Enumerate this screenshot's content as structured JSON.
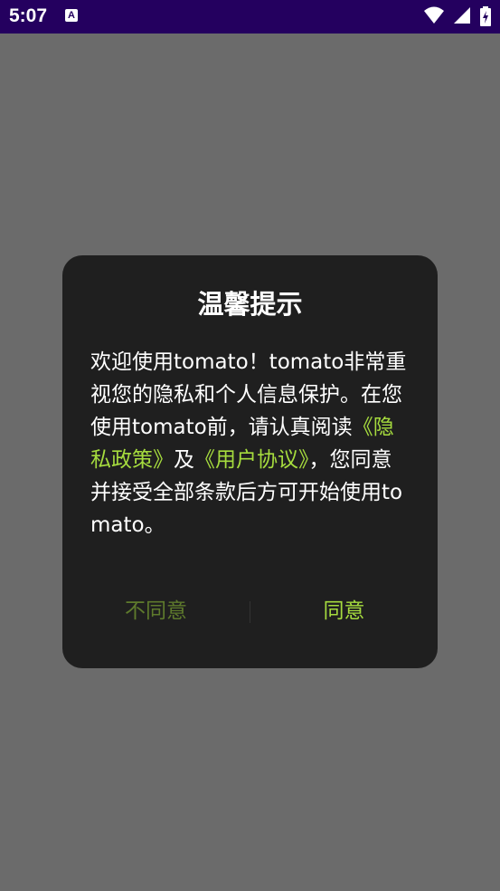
{
  "status_bar": {
    "time": "5:07",
    "app_icon_letter": "A",
    "icons": [
      "wifi-icon",
      "signal-icon",
      "battery-charging-icon"
    ]
  },
  "dialog": {
    "title": "温馨提示",
    "body": {
      "intro": "欢迎使用tomato！tomato非常重视您的隐私和个人信息保护。在您使用tomato前，请认真阅读",
      "privacy_link": "《隐私政策》",
      "and": "及",
      "agreement_link": "《用户协议》",
      "outro": "，您同意并接受全部条款后方可开始使用tomato。"
    },
    "disagree_label": "不同意",
    "agree_label": "同意"
  },
  "colors": {
    "status_bar": "#24005f",
    "overlay": "#6b6b6b",
    "dialog_bg": "#1f1f1f",
    "accent": "#a6dc3e",
    "accent_muted": "#5e7a2c"
  }
}
